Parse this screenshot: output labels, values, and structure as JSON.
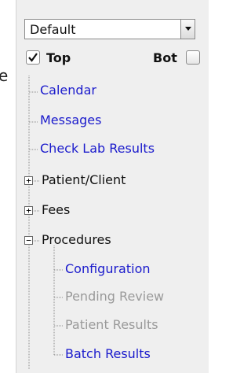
{
  "edge_glyph": "e",
  "view_select": {
    "value": "Default"
  },
  "toggles": {
    "top_label": "Top",
    "bot_label": "Bot"
  },
  "tree": {
    "calendar": "Calendar",
    "messages": "Messages",
    "check_lab_results": "Check Lab Results",
    "patient_client": "Patient/Client",
    "fees": "Fees",
    "procedures": "Procedures",
    "configuration": "Configuration",
    "pending_review": "Pending Review",
    "patient_results": "Patient Results",
    "batch_results": "Batch Results"
  },
  "colors": {
    "link": "#1a1acc",
    "disabled": "#9a9a9a"
  },
  "icons": {
    "dropdown": "chevron-down-icon",
    "check": "check-icon",
    "expand": "plus-box-icon",
    "collapse": "minus-box-icon"
  }
}
